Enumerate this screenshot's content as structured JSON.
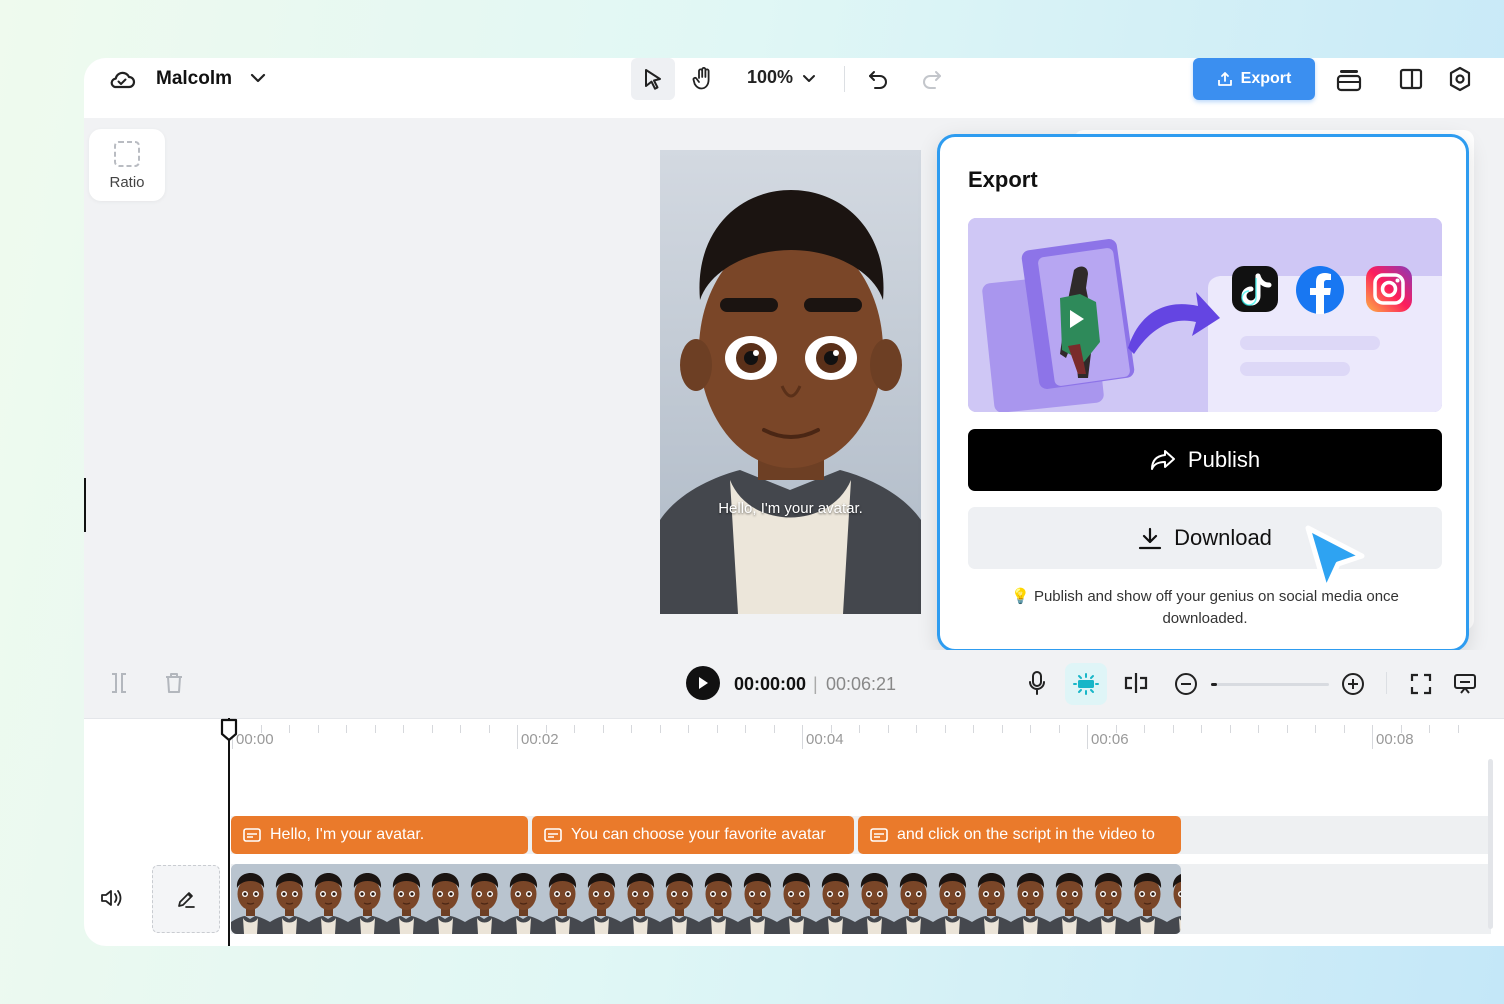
{
  "header": {
    "project_name": "Malcolm",
    "zoom": "100%",
    "export_label": "Export"
  },
  "sidebar": {
    "ratio_label": "Ratio"
  },
  "preview": {
    "caption": "Hello, I'm your avatar."
  },
  "export_panel": {
    "title": "Export",
    "publish_label": "Publish",
    "download_label": "Download",
    "note": "Publish and show off your genius on social media once downloaded.",
    "social_icons": [
      "tiktok-icon",
      "facebook-icon",
      "instagram-icon"
    ]
  },
  "player": {
    "current_time": "00:00:00",
    "separator": "|",
    "total_time": "00:06:21",
    "zoom_level": 0.05
  },
  "timeline": {
    "ticks": [
      "00:00",
      "00:02",
      "00:04",
      "00:06",
      "00:08"
    ],
    "subtitle_clips": [
      "Hello, I'm your avatar.",
      "You can choose your favorite avatar",
      "and click on the script in the video to"
    ]
  },
  "colors": {
    "accent": "#3b8ff0",
    "panel_border": "#2e9cf0",
    "clip": "#ea7a2b",
    "cursor": "#2ea3f2"
  }
}
